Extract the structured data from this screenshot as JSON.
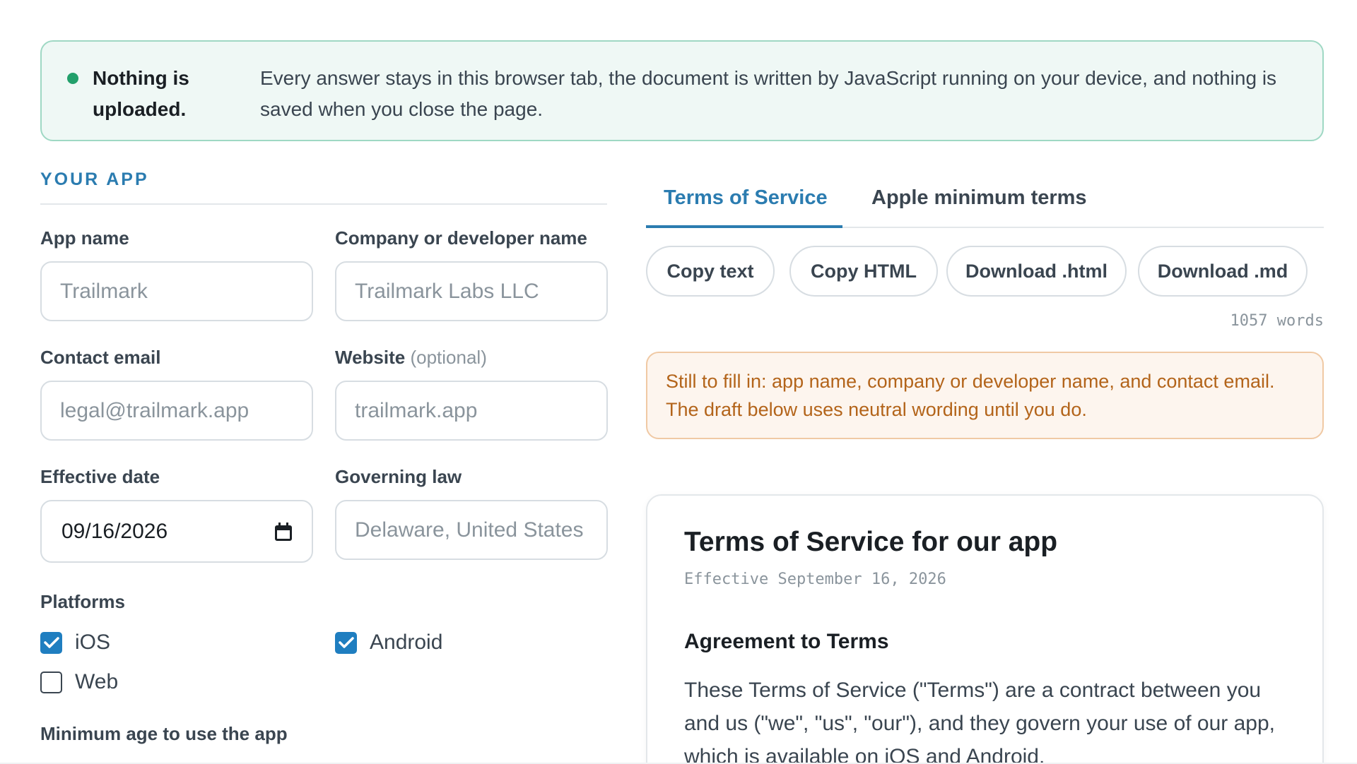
{
  "notice": {
    "title": "Nothing is uploaded.",
    "text": "Every answer stays in this browser tab, the document is written by JavaScript running on your device, and nothing is saved when you close the page."
  },
  "form": {
    "section_title": "YOUR APP",
    "app_name": {
      "label": "App name",
      "placeholder": "Trailmark"
    },
    "company": {
      "label": "Company or developer name",
      "placeholder": "Trailmark Labs LLC"
    },
    "email": {
      "label": "Contact email",
      "placeholder": "legal@trailmark.app"
    },
    "website": {
      "label": "Website",
      "label_note": "(optional)",
      "placeholder": "trailmark.app"
    },
    "effective_date": {
      "label": "Effective date",
      "value": "09/16/2026"
    },
    "governing_law": {
      "label": "Governing law",
      "placeholder": "Delaware, United States"
    },
    "platforms": {
      "label": "Platforms",
      "items": [
        {
          "label": "iOS",
          "checked": true
        },
        {
          "label": "Android",
          "checked": true
        },
        {
          "label": "Web",
          "checked": false
        }
      ]
    },
    "min_age_label": "Minimum age to use the app"
  },
  "preview": {
    "tabs": [
      "Terms of Service",
      "Apple minimum terms"
    ],
    "active_tab": 0,
    "actions": [
      "Copy text",
      "Copy HTML",
      "Download .html",
      "Download .md"
    ],
    "word_count": "1057 words",
    "warning": "Still to fill in: app name, company or developer name, and contact email. The draft below uses neutral wording until you do.",
    "doc": {
      "title": "Terms of Service for our app",
      "effective": "Effective September 16, 2026",
      "heading": "Agreement to Terms",
      "paragraph": "These Terms of Service (\"Terms\") are a contract between you and us (\"we\", \"us\", \"our\"), and they govern your use of our app, which is available on iOS and Android."
    }
  },
  "colors": {
    "accent": "#2b7cb0",
    "success": "#22a06b",
    "warning_text": "#b3641a",
    "checkbox": "#1f7ec0"
  }
}
